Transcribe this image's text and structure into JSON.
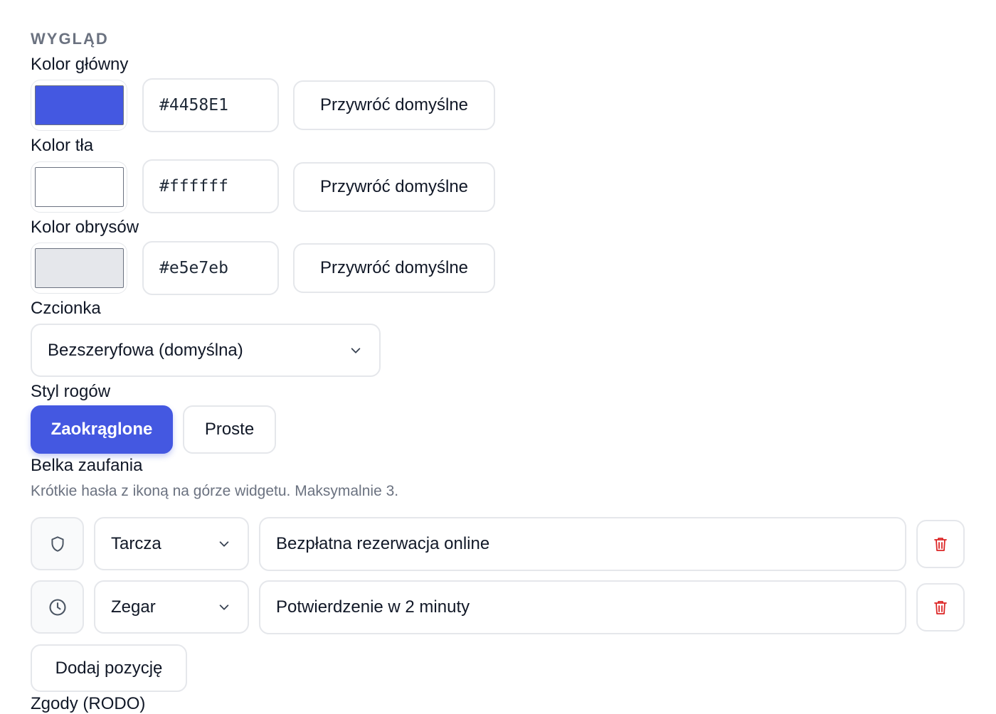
{
  "appearance": {
    "section_title": "WYGLĄD",
    "primary_color": {
      "label": "Kolor główny",
      "value": "#4458E1",
      "swatch": "#4458E1",
      "reset_label": "Przywróć domyślne"
    },
    "background_color": {
      "label": "Kolor tła",
      "value": "#ffffff",
      "swatch": "#ffffff",
      "reset_label": "Przywróć domyślne"
    },
    "border_color": {
      "label": "Kolor obrysów",
      "value": "#e5e7eb",
      "swatch": "#e5e7eb",
      "reset_label": "Przywróć domyślne"
    },
    "font": {
      "label": "Czcionka",
      "selected": "Bezszeryfowa (domyślna)"
    },
    "corners": {
      "label": "Styl rogów",
      "options": [
        "Zaokrąglone",
        "Proste"
      ],
      "selected": "Zaokrąglone"
    }
  },
  "trust_bar": {
    "title": "Belka zaufania",
    "description": "Krótkie hasła z ikoną na górze widgetu. Maksymalnie 3.",
    "items": [
      {
        "icon": "shield-icon",
        "icon_label": "Tarcza",
        "text": "Bezpłatna rezerwacja online"
      },
      {
        "icon": "clock-icon",
        "icon_label": "Zegar",
        "text": "Potwierdzenie w 2 minuty"
      }
    ],
    "add_label": "Dodaj pozycję"
  },
  "consents": {
    "title": "Zgody (RODO)"
  },
  "colors": {
    "accent": "#4458E1",
    "danger": "#dc2626",
    "border": "#e5e7eb",
    "muted": "#6b7280"
  }
}
